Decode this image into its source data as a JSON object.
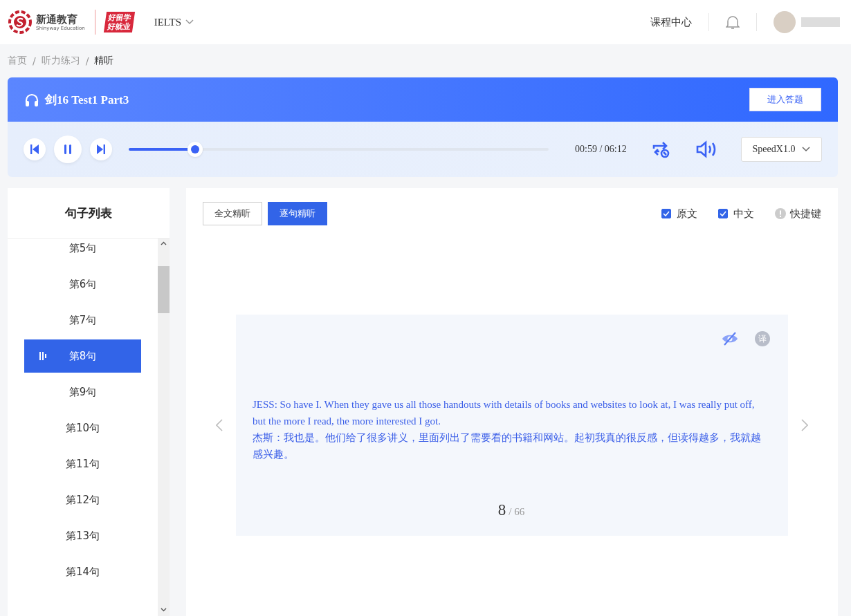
{
  "header": {
    "logo_name": "新通教育",
    "logo_sub": "Shinyway Education",
    "slogan_top": "好留学",
    "slogan_bottom": "好就业",
    "exam": "IELTS",
    "nav_link": "课程中心"
  },
  "breadcrumb": [
    "首页",
    "听力练习",
    "精听"
  ],
  "breadcrumb_separator": "/",
  "player": {
    "title": "剑16 Test1 Part3",
    "enter_button": "进入答题",
    "progress": {
      "level": 0.158
    },
    "time": "00:59 / 06:12",
    "playing": true,
    "speed": "SpeedX1.0"
  },
  "sentence_list": {
    "title": "句子列表",
    "items": [
      {
        "label": "第5句",
        "selected": false
      },
      {
        "label": "第6句",
        "selected": false
      },
      {
        "label": "第7句",
        "selected": false
      },
      {
        "label": "第8句",
        "selected": true
      },
      {
        "label": "第9句",
        "selected": false
      },
      {
        "label": "第10句",
        "selected": false
      },
      {
        "label": "第11句",
        "selected": false
      },
      {
        "label": "第12句",
        "selected": false
      },
      {
        "label": "第13句",
        "selected": false
      },
      {
        "label": "第14句",
        "selected": false
      }
    ]
  },
  "modes": [
    {
      "label": "全文精听",
      "selected": false
    },
    {
      "label": "逐句精听",
      "selected": true
    }
  ],
  "options": [
    {
      "label": "原文",
      "checked": true
    },
    {
      "label": "中文",
      "checked": true
    }
  ],
  "shortcuts": "快捷键",
  "sentence": {
    "english": "JESS: So have I. When they gave us all those handouts with details of books and websites to look at, I was really put off, but the more I read, the more interested I got.",
    "chinese": "杰斯：我也是。他们给了很多讲义，里面列出了需要看的书籍和网站。起初我真的很反感，但读得越多，我就越感兴趣。",
    "translate_icon": "译",
    "current": "8",
    "total": "/ 66"
  }
}
